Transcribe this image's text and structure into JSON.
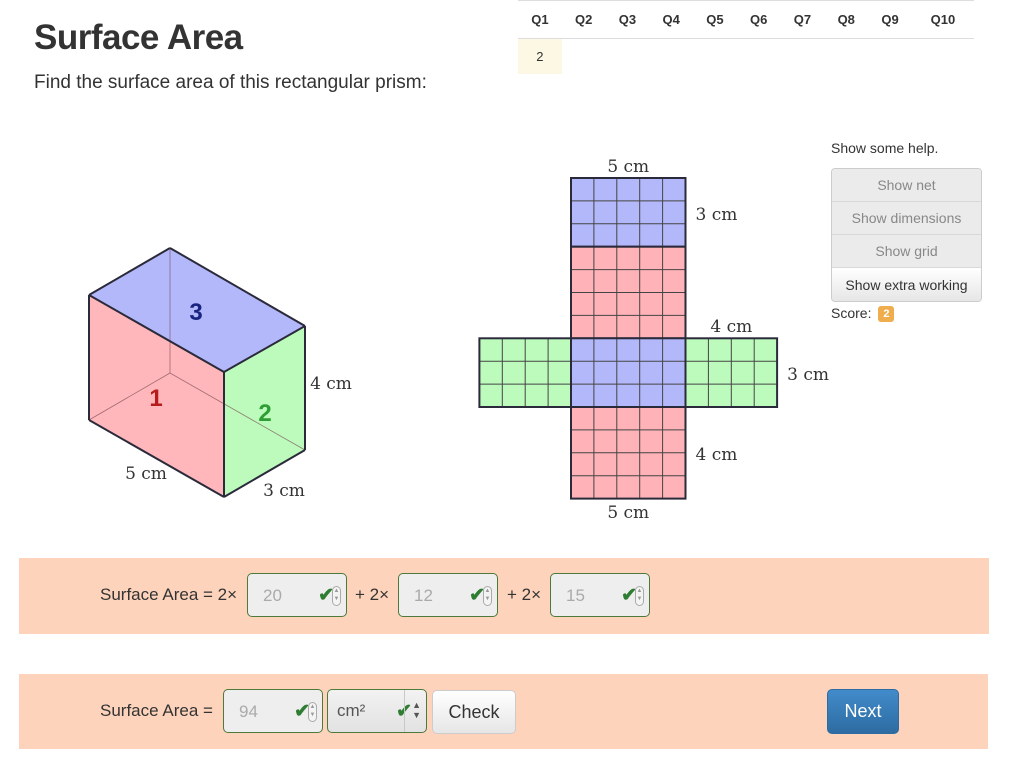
{
  "header": {
    "title": "Surface Area",
    "prompt": "Find the surface area of this rectangular prism:"
  },
  "question_table": {
    "headers": [
      "Q1",
      "Q2",
      "Q3",
      "Q4",
      "Q5",
      "Q6",
      "Q7",
      "Q8",
      "Q9",
      "Q10"
    ],
    "scores": [
      "2",
      "",
      "",
      "",
      "",
      "",
      "",
      "",
      "",
      ""
    ]
  },
  "help": {
    "label": "Show some help.",
    "buttons": [
      {
        "label": "Show net",
        "active": false
      },
      {
        "label": "Show dimensions",
        "active": false
      },
      {
        "label": "Show grid",
        "active": false
      },
      {
        "label": "Show extra working",
        "active": true
      }
    ],
    "score_label": "Score:",
    "score_value": "2"
  },
  "prism": {
    "length": "5 cm",
    "width": "3 cm",
    "height": "4 cm",
    "face_labels": [
      "1",
      "2",
      "3"
    ],
    "colors": {
      "front": "#ffb3b8",
      "side": "#bdfbbd",
      "top": "#b3b8fb",
      "front_label": "#b71c1c",
      "side_label": "#2e9d32",
      "top_label": "#1a237e"
    }
  },
  "net": {
    "labels": {
      "top_width": "5 cm",
      "top_height": "3 cm",
      "side_width": "4 cm",
      "side_height": "3 cm",
      "bottom_height": "4 cm",
      "bottom_width": "5 cm"
    },
    "length_units": 5,
    "width_units": 3,
    "height_units": 4
  },
  "working_row": {
    "label": "Surface Area = 2×",
    "plus1": "+ 2×",
    "plus2": "+ 2×",
    "values": [
      "20",
      "12",
      "15"
    ]
  },
  "answer_row": {
    "label": "Surface Area =",
    "value": "94",
    "unit": "cm²",
    "check_label": "Check",
    "next_label": "Next"
  }
}
